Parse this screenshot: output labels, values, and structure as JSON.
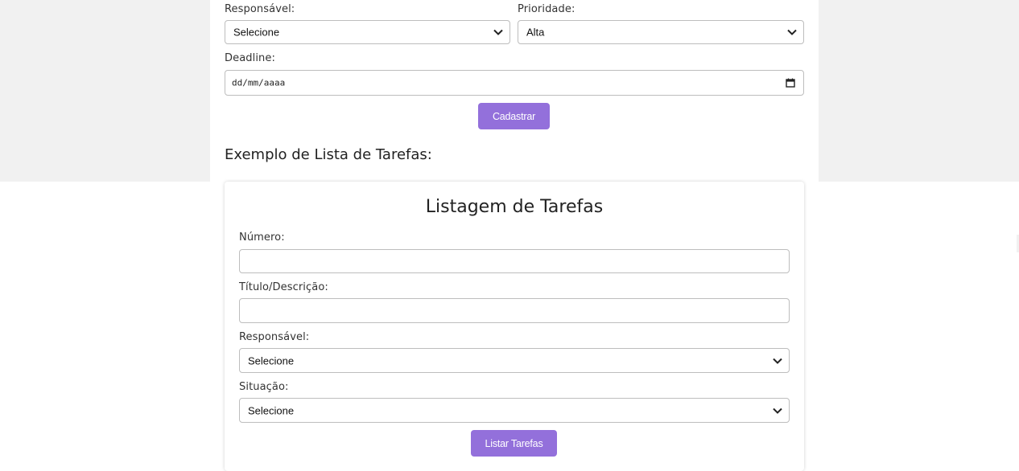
{
  "top_form": {
    "responsavel_label": "Responsável:",
    "responsavel_value": "Selecione",
    "prioridade_label": "Prioridade:",
    "prioridade_value": "Alta",
    "deadline_label": "Deadline:",
    "deadline_value": "dd/mm/aaaa",
    "submit_label": "Cadastrar"
  },
  "example_heading": "Exemplo de Lista de Tarefas:",
  "listing": {
    "title": "Listagem de Tarefas",
    "numero_label": "Número:",
    "numero_value": "",
    "titulo_label": "Título/Descrição:",
    "titulo_value": "",
    "responsavel_label": "Responsável:",
    "responsavel_value": "Selecione",
    "situacao_label": "Situação:",
    "situacao_value": "Selecione",
    "submit_label": "Listar Tarefas"
  },
  "icons": {
    "select_arrow": "chevron-down-icon",
    "date_picker": "calendar-icon"
  },
  "colors": {
    "accent": "#9370db",
    "background_top": "#f1f1f1",
    "panel": "#ffffff"
  }
}
